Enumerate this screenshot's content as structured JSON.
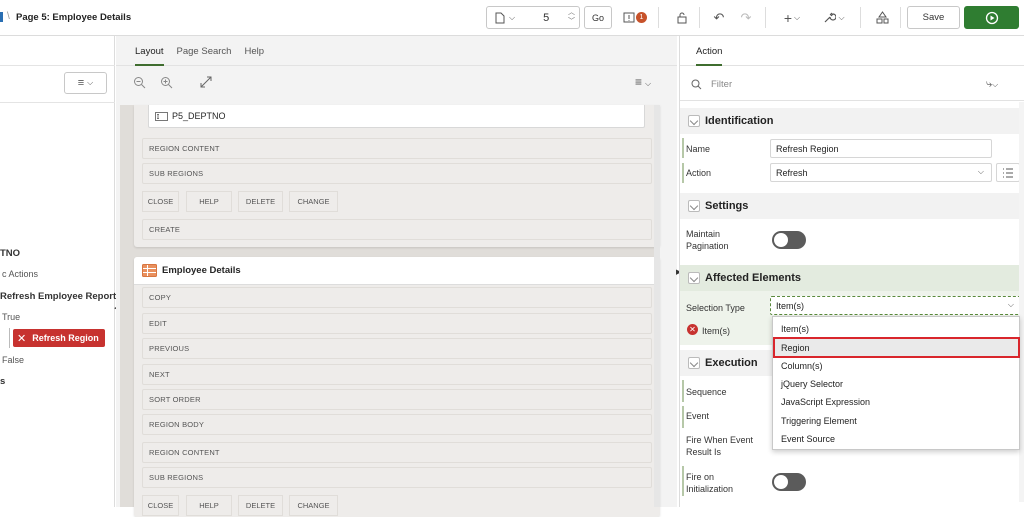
{
  "header": {
    "page_title": "Page 5: Employee Details",
    "page_number": "5",
    "go_label": "Go",
    "warning_count": "1",
    "save_label": "Save"
  },
  "left_tree": {
    "items": [
      {
        "label": "TNO"
      },
      {
        "label": "c Actions"
      },
      {
        "label": "Refresh Employee Report"
      },
      {
        "label": "True"
      },
      {
        "label": "Refresh Region"
      },
      {
        "label": "False"
      },
      {
        "label": "s"
      }
    ]
  },
  "middle": {
    "tabs": [
      {
        "label": "Layout"
      },
      {
        "label": "Page Search"
      },
      {
        "label": "Help"
      }
    ],
    "item_label": "P5_DEPTNO",
    "region1_slots": [
      "REGION CONTENT",
      "SUB REGIONS"
    ],
    "region1_buttons": [
      "CLOSE",
      "HELP",
      "DELETE",
      "CHANGE"
    ],
    "region1_create": "CREATE",
    "region2_title": "Employee Details",
    "region2_slots": [
      "COPY",
      "EDIT",
      "PREVIOUS",
      "NEXT",
      "SORT ORDER",
      "REGION BODY",
      "REGION CONTENT",
      "SUB REGIONS"
    ],
    "region2_buttons": [
      "CLOSE",
      "HELP",
      "DELETE",
      "CHANGE"
    ]
  },
  "right": {
    "tab_label": "Action",
    "filter_placeholder": "Filter",
    "identification": {
      "title": "Identification",
      "name_label": "Name",
      "name_value": "Refresh Region",
      "action_label": "Action",
      "action_value": "Refresh"
    },
    "settings": {
      "title": "Settings",
      "maintain_pagination_label": "Maintain Pagination"
    },
    "affected": {
      "title": "Affected Elements",
      "selection_type_label": "Selection Type",
      "selection_type_value": "Item(s)",
      "items_label": "Item(s)"
    },
    "execution": {
      "title": "Execution",
      "sequence_label": "Sequence",
      "event_label": "Event",
      "fire_when_label": "Fire When Event Result Is",
      "fire_on_init_label": "Fire on Initialization"
    },
    "dropdown_options": [
      {
        "label": "Item(s)"
      },
      {
        "label": "Region"
      },
      {
        "label": "Column(s)"
      },
      {
        "label": "jQuery Selector"
      },
      {
        "label": "JavaScript Expression"
      },
      {
        "label": "Triggering Element"
      },
      {
        "label": "Event Source"
      }
    ]
  },
  "colors": {
    "accent_green": "#2f7d31",
    "danger_red": "#c7322f",
    "highlight_outline": "#d9262c"
  }
}
